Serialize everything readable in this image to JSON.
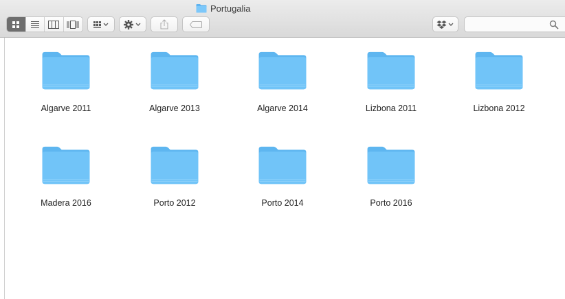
{
  "window": {
    "title": "Portugalia"
  },
  "toolbar": {
    "view_modes": [
      "icon-view",
      "list-view",
      "column-view",
      "cover-flow-view"
    ],
    "active_view": "icon-view",
    "arrange_button": "arrange-icon",
    "action_button": "gear-icon",
    "share_button": "share-icon",
    "tags_button": "tag-icon",
    "dropbox_button": "dropbox-icon"
  },
  "search": {
    "placeholder": "",
    "value": ""
  },
  "colors": {
    "folder": "#71c4f8",
    "folder_back": "#5eb6f0",
    "active_segment": "#6e6e6e"
  },
  "folders": [
    {
      "name": "Algarve 2011"
    },
    {
      "name": "Algarve 2013"
    },
    {
      "name": "Algarve 2014"
    },
    {
      "name": "Lizbona 2011"
    },
    {
      "name": "Lizbona 2012"
    },
    {
      "name": "Madera 2016"
    },
    {
      "name": "Porto 2012"
    },
    {
      "name": "Porto 2014"
    },
    {
      "name": "Porto 2016"
    }
  ]
}
